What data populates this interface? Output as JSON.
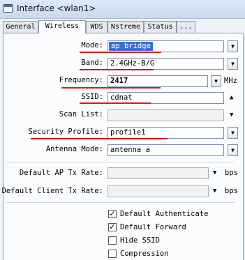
{
  "window": {
    "title": "Interface <wlan1>"
  },
  "tabs": [
    {
      "label": "General"
    },
    {
      "label": "Wireless"
    },
    {
      "label": "WDS"
    },
    {
      "label": "Nstreme"
    },
    {
      "label": "Status"
    },
    {
      "label": "..."
    }
  ],
  "active_tab": "Wireless",
  "form": {
    "mode": {
      "label": "Mode:",
      "value": "ap bridge"
    },
    "band": {
      "label": "Band:",
      "value": "2.4GHz-B/G"
    },
    "frequency": {
      "label": "Frequency:",
      "value": "2417",
      "unit": "MHz"
    },
    "ssid": {
      "label": "SSID:",
      "value": "cdnat"
    },
    "scan_list": {
      "label": "Scan List:",
      "value": ""
    },
    "security_profile": {
      "label": "Security Profile:",
      "value": "profile1"
    },
    "antenna_mode": {
      "label": "Antenna Mode:",
      "value": "antenna a"
    },
    "default_ap_tx_rate": {
      "label": "Default AP Tx Rate:",
      "value": "",
      "unit": "bps"
    },
    "default_client_tx_rate": {
      "label": "Default Client Tx Rate:",
      "value": "",
      "unit": "bps"
    }
  },
  "checkboxes": [
    {
      "label": "Default Authenticate",
      "checked": true
    },
    {
      "label": "Default Forward",
      "checked": true
    },
    {
      "label": "Hide SSID",
      "checked": false
    },
    {
      "label": "Compression",
      "checked": false
    }
  ],
  "icons": {
    "dropdown": "chevron-down-icon",
    "triangle_down": "triangle-down-icon",
    "triangle_up": "triangle-up-icon",
    "check": "check-icon"
  },
  "colors": {
    "highlight": "#3a6fd8",
    "annotation_underline": "#e2141b"
  }
}
